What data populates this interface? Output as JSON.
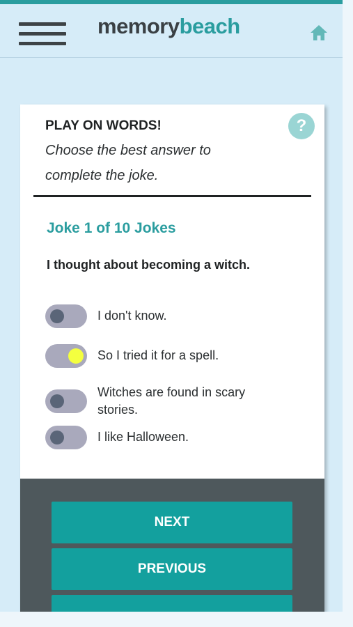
{
  "brand": {
    "part1": "memory",
    "part2": "beach"
  },
  "activity": {
    "title": "PLAY ON WORDS!",
    "instruction": "Choose the best answer to complete the joke.",
    "counter": "Joke 1 of 10 Jokes",
    "question": "I thought about becoming a witch.",
    "help_symbol": "?"
  },
  "options": [
    {
      "label": "I don't know.",
      "selected": false
    },
    {
      "label": "So I tried it for a spell.",
      "selected": true
    },
    {
      "label": "Witches are found in scary stories.",
      "selected": false
    },
    {
      "label": "I like Halloween.",
      "selected": false
    }
  ],
  "buttons": {
    "next": "NEXT",
    "previous": "PREVIOUS"
  },
  "colors": {
    "accent": "#2a9d9f",
    "button": "#13a09e",
    "footer": "#4e585c",
    "toggle_on_knob": "#f4ff3f"
  },
  "icons": {
    "menu": "hamburger-menu-icon",
    "home": "home-icon",
    "help": "help-icon"
  }
}
